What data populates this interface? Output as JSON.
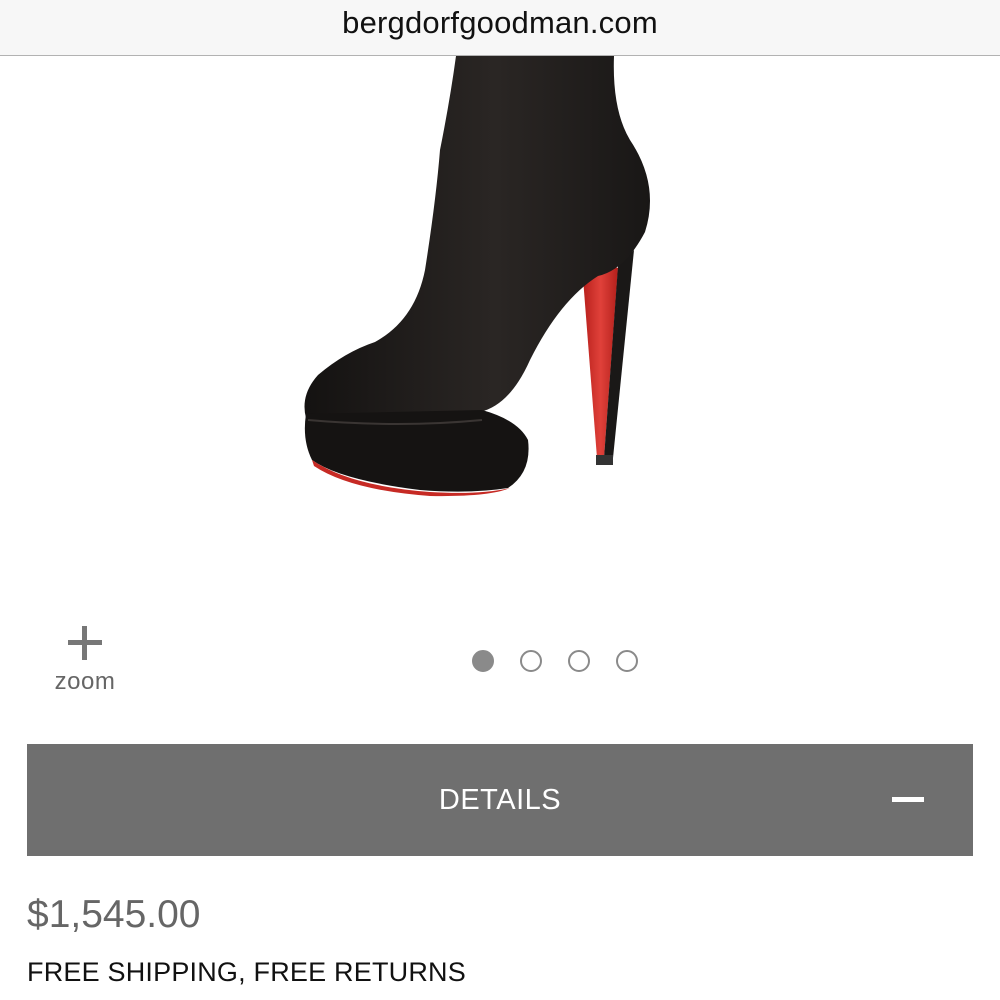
{
  "browser": {
    "url": "bergdorfgoodman.com"
  },
  "product": {
    "image_alt": "Black suede platform boot with red sole",
    "price": "$1,545.00",
    "shipping_note": "FREE SHIPPING, FREE RETURNS"
  },
  "gallery": {
    "zoom_label": "zoom",
    "active_index": 0,
    "dot_count": 4
  },
  "details": {
    "label": "DETAILS",
    "expanded": true
  },
  "colors": {
    "details_bar": "#6f6f6f",
    "sole_red": "#d5302c",
    "boot_black": "#1e1b1a",
    "indicator_gray": "#8a8a8a"
  },
  "icons": [
    "plus-icon",
    "minus-icon"
  ]
}
